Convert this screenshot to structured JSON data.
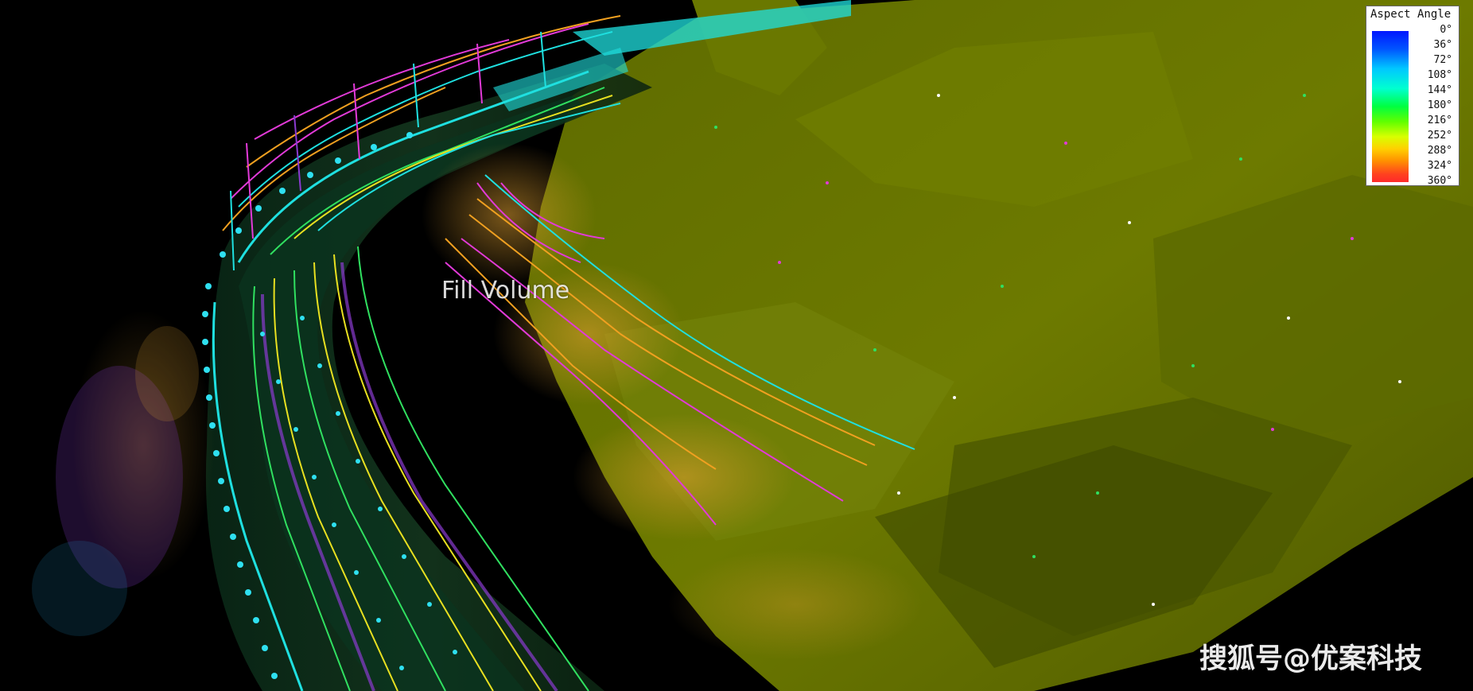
{
  "overlay_label": "Fill Volume",
  "legend": {
    "title": "Aspect Angle",
    "ticks": [
      "0°",
      "36°",
      "72°",
      "108°",
      "144°",
      "180°",
      "216°",
      "252°",
      "288°",
      "324°",
      "360°"
    ],
    "colors": [
      "#0016ff",
      "#0055ff",
      "#00c8ff",
      "#00ffd0",
      "#00ff40",
      "#60ff00",
      "#d8ff00",
      "#ffd000",
      "#ff9000",
      "#ff4020",
      "#ff2a2a"
    ]
  },
  "watermark": "搜狐号@优案科技",
  "colors": {
    "background": "#000000",
    "terrain": "#6b7a00",
    "terrain_dark": "#3a4a00",
    "rail_cyan": "#1fe0e0",
    "rail_magenta": "#e23ad8",
    "rail_orange": "#f0a020",
    "rail_yellow": "#e8e020",
    "rail_green": "#30e060",
    "points_orange": "#f0a030",
    "points_purple": "#8a3ad0"
  }
}
